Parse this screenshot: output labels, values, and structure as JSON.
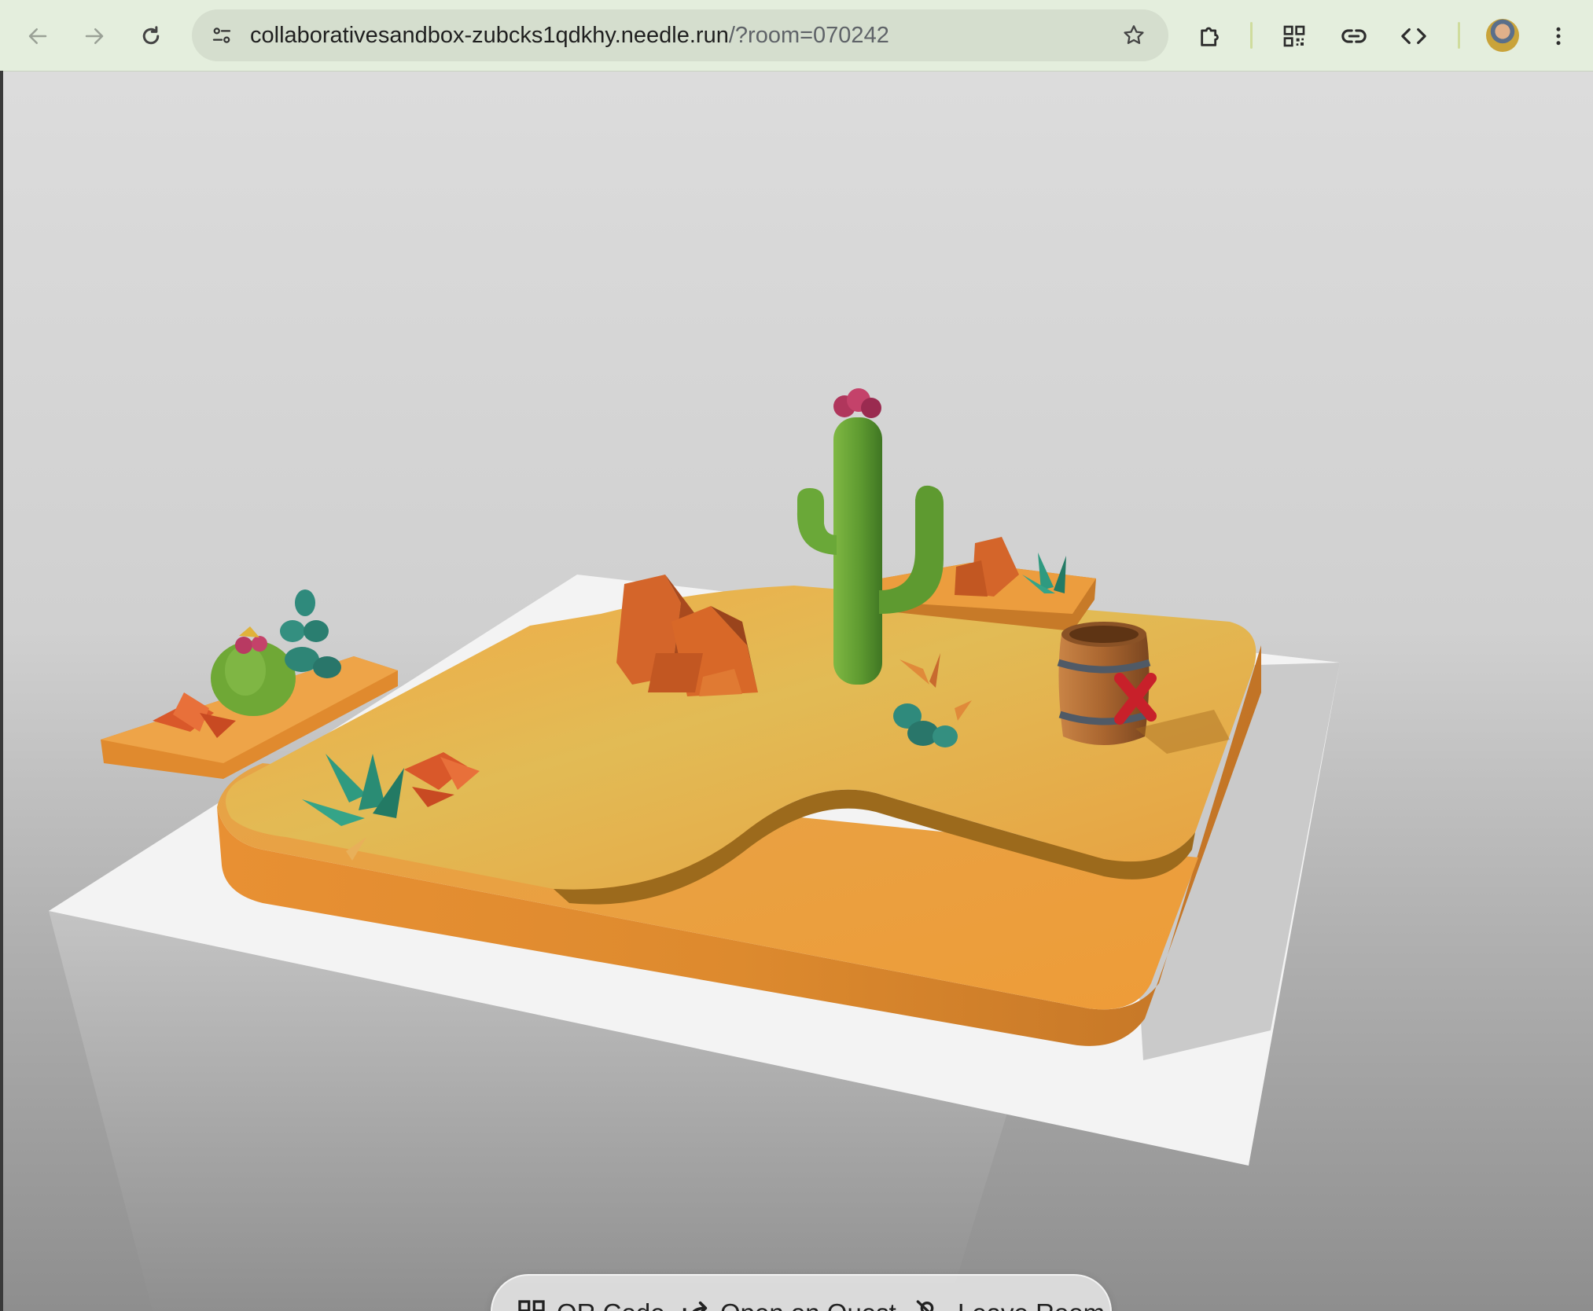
{
  "browser": {
    "url_host": "collaborativesandbox-zubcks1qdkhy.needle.run",
    "url_rest": "/?room=070242",
    "icons": [
      "back-arrow-icon",
      "forward-arrow-icon",
      "reload-icon",
      "site-settings-icon",
      "bookmark-star-icon",
      "extensions-icon",
      "qr-code-icon",
      "link-icon",
      "code-icon",
      "profile-avatar",
      "more-menu-icon"
    ]
  },
  "scene": {
    "description_objects": [
      "saguaro-cactus",
      "barrel-cactus",
      "rock-formation",
      "barrel-with-x",
      "agave-plant",
      "succulent",
      "floating-platform"
    ],
    "colors": {
      "sand_top": "#e8b04a",
      "sand_edge": "#e8902c",
      "base_slab": "#f2f2f2",
      "cactus": "#5b9a32"
    }
  },
  "menu": {
    "qr_label": "QR Code",
    "quest_label": "Open on Quest",
    "leave_label": "Leave Room"
  }
}
